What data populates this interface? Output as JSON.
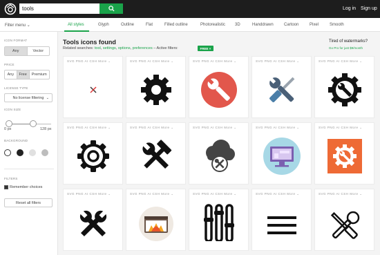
{
  "header": {
    "search_value": "tools",
    "login": "Log in",
    "signup": "Sign up"
  },
  "tabs": {
    "filter_menu": "Filter menu",
    "items": [
      "All styles",
      "Glyph",
      "Outline",
      "Flat",
      "Filled outline",
      "Photorealistic",
      "3D",
      "Handdrawn",
      "Cartoon",
      "Pixel",
      "Smooth"
    ],
    "active_index": 0
  },
  "sidebar": {
    "format_label": "Icon format",
    "format_options": [
      "Any",
      "Vector"
    ],
    "format_selected": 0,
    "price_label": "Price",
    "price_options": [
      "Any",
      "Free",
      "Premium"
    ],
    "price_selected": 1,
    "license_label": "License type",
    "license_value": "No license filtering",
    "size_label": "Icon size",
    "size_min": "0 px",
    "size_max": "128 px",
    "background_label": "Background",
    "background_colors": [
      "#ffffff",
      "#222222",
      "#e0e0e0",
      "#bdbdbd"
    ],
    "filters_label": "Filters",
    "remember_choices": "Remember choices",
    "reset": "Reset all filters"
  },
  "main": {
    "title": "Tools icons found",
    "related_prefix": "Related searches:",
    "related_links": [
      "tool",
      "settings",
      "options",
      "preferences"
    ],
    "active_filters_label": "– Active filters:",
    "free_chip": "FREE ×",
    "promo_title": "Tired of watermarks?",
    "promo_link": "Go Pro for just $9/month"
  },
  "card_formats": "SVG PNG AI CSH More ⌄",
  "icons": [
    {
      "name": "small-tools-icon"
    },
    {
      "name": "gear-icon"
    },
    {
      "name": "wrench-red-circle-icon"
    },
    {
      "name": "screwdriver-wrench-icon"
    },
    {
      "name": "gear-wrench-icon"
    },
    {
      "name": "gear-outline-icon"
    },
    {
      "name": "hammer-wrench-icon"
    },
    {
      "name": "cloud-tools-icon"
    },
    {
      "name": "computer-screen-icon"
    },
    {
      "name": "orange-gear-wrench-icon"
    },
    {
      "name": "wrench-cross-icon"
    },
    {
      "name": "browser-fire-icon"
    },
    {
      "name": "sliders-icon"
    },
    {
      "name": "menu-icon"
    },
    {
      "name": "crossed-tools-icon"
    }
  ],
  "colors": {
    "accent": "#1aa34a",
    "topbar": "#1d1d1d"
  }
}
